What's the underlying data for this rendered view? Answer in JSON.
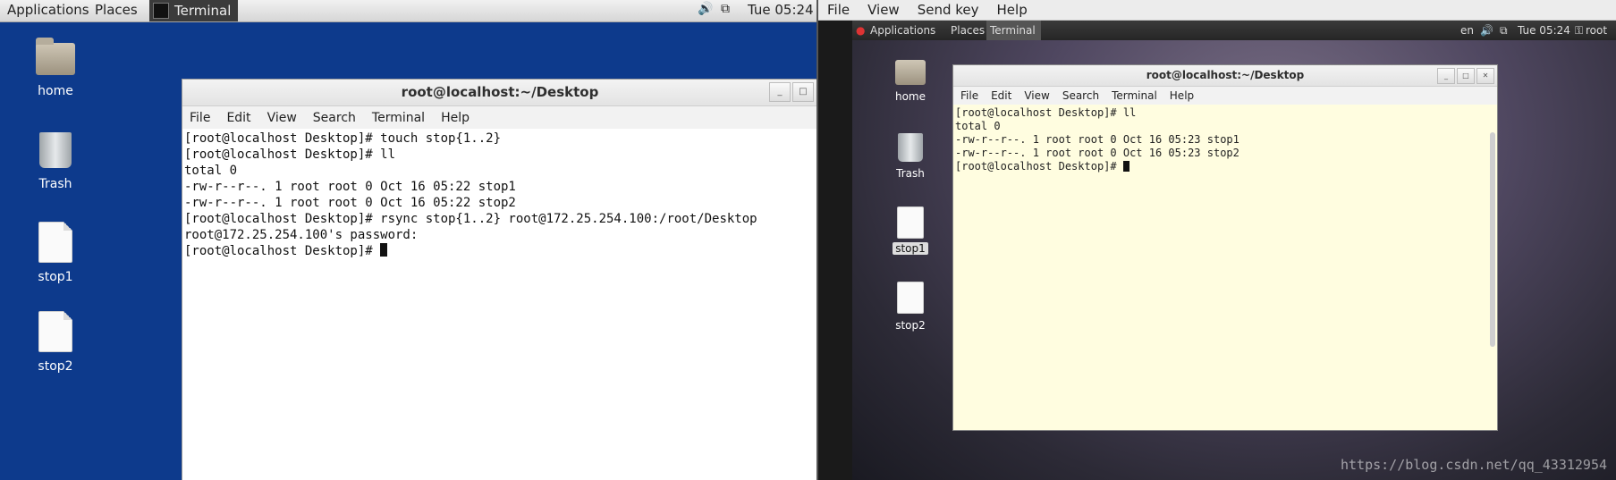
{
  "left": {
    "panel": {
      "applications": "Applications",
      "places": "Places",
      "task_label": "Terminal",
      "clock": "Tue 05:24"
    },
    "desktop_icons": [
      "home",
      "Trash",
      "stop1",
      "stop2"
    ],
    "window": {
      "title": "root@localhost:~/Desktop",
      "menu": [
        "File",
        "Edit",
        "View",
        "Search",
        "Terminal",
        "Help"
      ],
      "lines": [
        "[root@localhost Desktop]# touch stop{1..2}",
        "[root@localhost Desktop]# ll",
        "total 0",
        "-rw-r--r--. 1 root root 0 Oct 16 05:22 stop1",
        "-rw-r--r--. 1 root root 0 Oct 16 05:22 stop2",
        "[root@localhost Desktop]# rsync stop{1..2} root@172.25.254.100:/root/Desktop",
        "root@172.25.254.100's password:"
      ],
      "prompt": "[root@localhost Desktop]# "
    }
  },
  "right": {
    "viewer_menu": [
      "File",
      "View",
      "Send key",
      "Help"
    ],
    "panel": {
      "applications": "Applications",
      "places": "Places",
      "task_label": "Terminal",
      "lang": "en",
      "clock": "Tue 05:24",
      "user": "root"
    },
    "desktop_icons": [
      "home",
      "Trash",
      "stop1",
      "stop2"
    ],
    "window": {
      "title": "root@localhost:~/Desktop",
      "menu": [
        "File",
        "Edit",
        "View",
        "Search",
        "Terminal",
        "Help"
      ],
      "lines": [
        "[root@localhost Desktop]# ll",
        "total 0",
        "-rw-r--r--. 1 root root 0 Oct 16 05:23 stop1",
        "-rw-r--r--. 1 root root 0 Oct 16 05:23 stop2"
      ],
      "prompt": "[root@localhost Desktop]# "
    },
    "watermark": "https://blog.csdn.net/qq_43312954"
  },
  "colors": {
    "left_desktop": "#0d3a8c",
    "terminal_bg_right": "#fffde0"
  }
}
